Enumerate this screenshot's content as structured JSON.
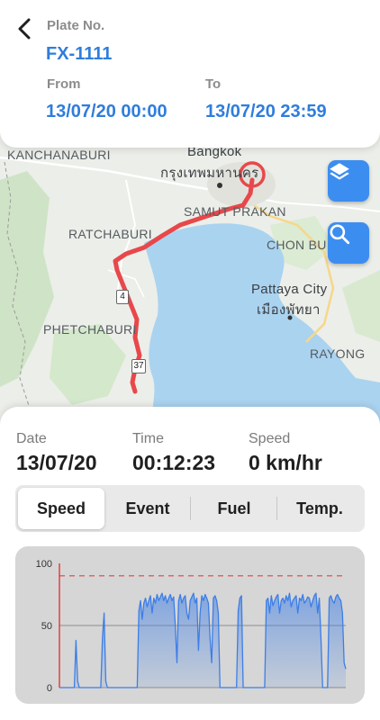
{
  "header": {
    "plate_label": "Plate No.",
    "plate_value": "FX-1111",
    "from_label": "From",
    "from_value": "13/07/20 00:00",
    "to_label": "To",
    "to_value": "13/07/20 23:59"
  },
  "map": {
    "labels": {
      "kanchanaburi": "KANCHANABURI",
      "bangkok": "Bangkok",
      "bangkok_thai": "กรุงเทพมหานคร",
      "samut_prakan": "SAMUT PRAKAN",
      "ratchaburi": "RATCHABURI",
      "chon_buri": "CHON BU",
      "pattaya": "Pattaya City",
      "pattaya_thai": "เมืองพัทยา",
      "phetchaburi": "PHETCHABURI",
      "rayong": "RAYONG"
    },
    "shields": {
      "route_4": "4",
      "route_37": "37"
    },
    "layers_button_icon": "layers-icon",
    "search_button_icon": "search-icon",
    "route_color": "#e8484b",
    "water_color": "#aad3f0"
  },
  "info": {
    "date_label": "Date",
    "date_value": "13/07/20",
    "time_label": "Time",
    "time_value": "00:12:23",
    "speed_label": "Speed",
    "speed_value": "0 km/hr"
  },
  "tabs": [
    {
      "label": "Speed",
      "active": true
    },
    {
      "label": "Event",
      "active": false
    },
    {
      "label": "Fuel",
      "active": false
    },
    {
      "label": "Temp.",
      "active": false
    }
  ],
  "chart_data": {
    "type": "area",
    "ylim": [
      0,
      100
    ],
    "yticks": [
      "100",
      "50",
      "0"
    ],
    "threshold": 90,
    "series_color": "#3d7ee6",
    "threshold_color": "#e04040",
    "values": [
      0,
      0,
      0,
      0,
      0,
      0,
      0,
      0,
      0,
      0,
      38,
      5,
      0,
      0,
      0,
      0,
      0,
      0,
      0,
      0,
      0,
      0,
      0,
      0,
      0,
      0,
      40,
      60,
      5,
      0,
      0,
      0,
      0,
      0,
      0,
      0,
      0,
      0,
      0,
      0,
      0,
      0,
      0,
      0,
      0,
      0,
      0,
      0,
      62,
      70,
      55,
      68,
      72,
      65,
      70,
      74,
      60,
      72,
      68,
      75,
      70,
      73,
      76,
      70,
      74,
      68,
      72,
      75,
      70,
      73,
      50,
      20,
      70,
      75,
      68,
      72,
      74,
      60,
      55,
      70,
      73,
      76,
      68,
      72,
      30,
      60,
      74,
      70,
      75,
      72,
      68,
      40,
      20,
      72,
      74,
      70,
      60,
      0,
      0,
      0,
      0,
      0,
      0,
      0,
      0,
      0,
      0,
      0,
      62,
      72,
      74,
      0,
      0,
      0,
      0,
      0,
      0,
      0,
      0,
      0,
      0,
      0,
      0,
      0,
      0,
      70,
      72,
      60,
      74,
      66,
      70,
      73,
      75,
      60,
      70,
      72,
      68,
      74,
      70,
      76,
      65,
      70,
      72,
      74,
      60,
      72,
      70,
      75,
      68,
      70,
      73,
      72,
      65,
      70,
      74,
      76,
      60,
      72,
      40,
      0,
      0,
      0,
      0,
      72,
      74,
      70,
      68,
      73,
      75,
      72,
      70,
      60,
      20,
      15
    ]
  }
}
